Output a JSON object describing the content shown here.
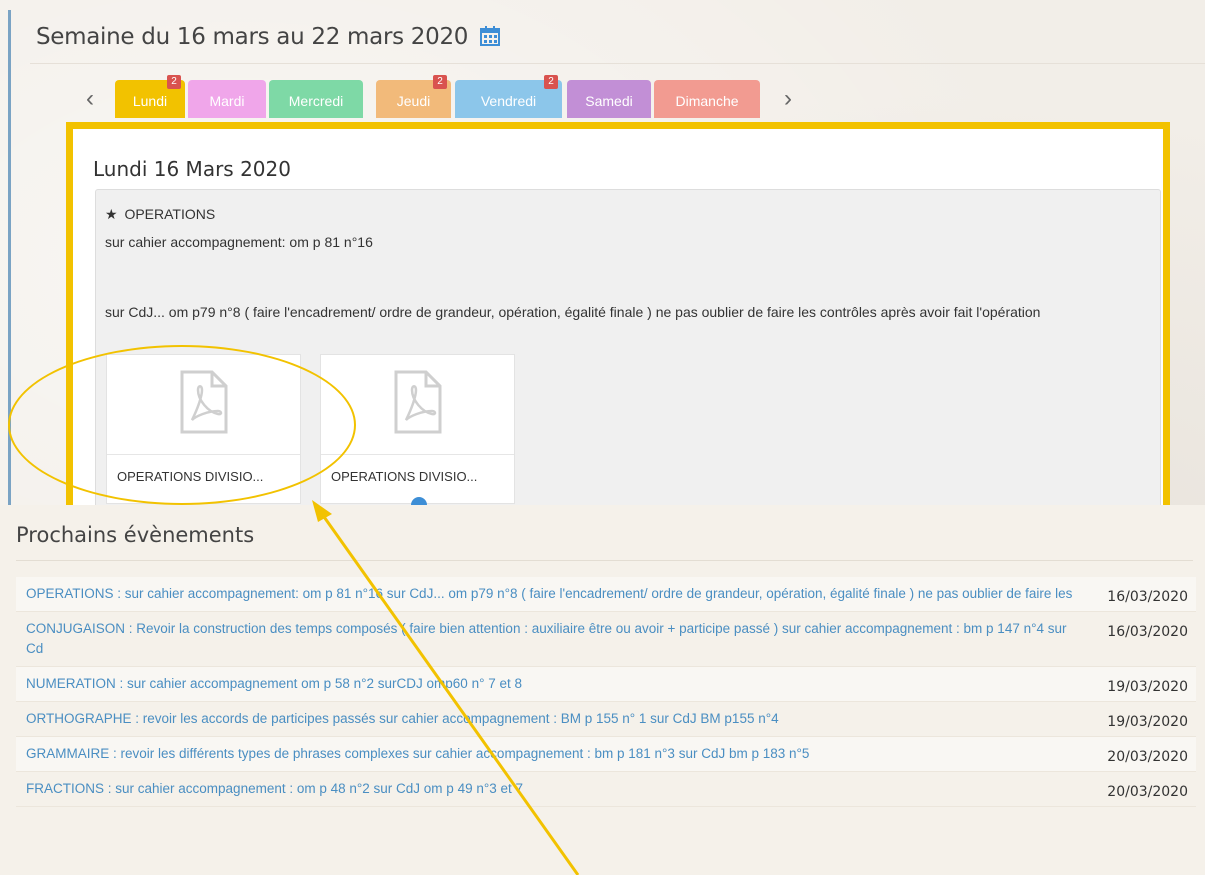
{
  "week": {
    "title": "Semaine du 16 mars au 22 mars 2020"
  },
  "tabs": [
    {
      "label": "Lundi",
      "color": "#f2c200",
      "badge": "2"
    },
    {
      "label": "Mardi",
      "color": "#f0a6ea",
      "badge": ""
    },
    {
      "label": "Mercredi",
      "color": "#7ed9a6",
      "badge": ""
    },
    {
      "label": "Jeudi",
      "color": "#f2ba7a",
      "badge": "2"
    },
    {
      "label": "Vendredi",
      "color": "#8cc6ea",
      "badge": "2"
    },
    {
      "label": "Samedi",
      "color": "#c28fd6",
      "badge": ""
    },
    {
      "label": "Dimanche",
      "color": "#f29b91",
      "badge": ""
    }
  ],
  "day": {
    "title": "Lundi 16 Mars 2020",
    "event": {
      "subject": "OPERATIONS",
      "line1": "sur cahier accompagnement: om p 81 n°16",
      "line2": "sur CdJ... om p79 n°8 ( faire l'encadrement/ ordre de grandeur, opération, égalité finale ) ne pas oublier de faire les contrôles après avoir fait l'opération"
    },
    "attachments": [
      {
        "label": "OPERATIONS DIVISIO..."
      },
      {
        "label": "OPERATIONS DIVISIO..."
      }
    ]
  },
  "upcoming": {
    "title": "Prochains évènements",
    "items": [
      {
        "text": "OPERATIONS : sur cahier accompagnement: om p 81 n°16 sur CdJ... om p79 n°8 ( faire l'encadrement/ ordre de grandeur, opération, égalité finale ) ne pas oublier de faire les",
        "date": "16/03/2020"
      },
      {
        "text": "CONJUGAISON : Revoir la construction des temps composés ( faire bien attention : auxiliaire être ou avoir + participe passé ) sur cahier accompagnement : bm p 147 n°4 sur Cd",
        "date": "16/03/2020"
      },
      {
        "text": "NUMERATION : sur cahier accompagnement om p 58 n°2 surCDJ omp60 n° 7 et 8",
        "date": "19/03/2020"
      },
      {
        "text": "ORTHOGRAPHE : revoir les accords de participes passés sur cahier accompagnement : BM p 155 n° 1 sur CdJ BM p155 n°4",
        "date": "19/03/2020"
      },
      {
        "text": "GRAMMAIRE : revoir les différents types de phrases complexes sur cahier accompagnement : bm p 181 n°3 sur CdJ bm p 183 n°5",
        "date": "20/03/2020"
      },
      {
        "text": "FRACTIONS : sur cahier accompagnement : om p 48 n°2 sur CdJ om p 49 n°3 et 7",
        "date": "20/03/2020"
      }
    ]
  },
  "icons": {
    "calendar": "calendar-icon",
    "star": "star-icon",
    "pdf": "pdf-file-icon",
    "prev": "chevron-left-icon",
    "next": "chevron-right-icon"
  },
  "colors": {
    "selected_frame": "#f2c200",
    "link": "#4a8ec2",
    "annotation": "#f2c200"
  }
}
